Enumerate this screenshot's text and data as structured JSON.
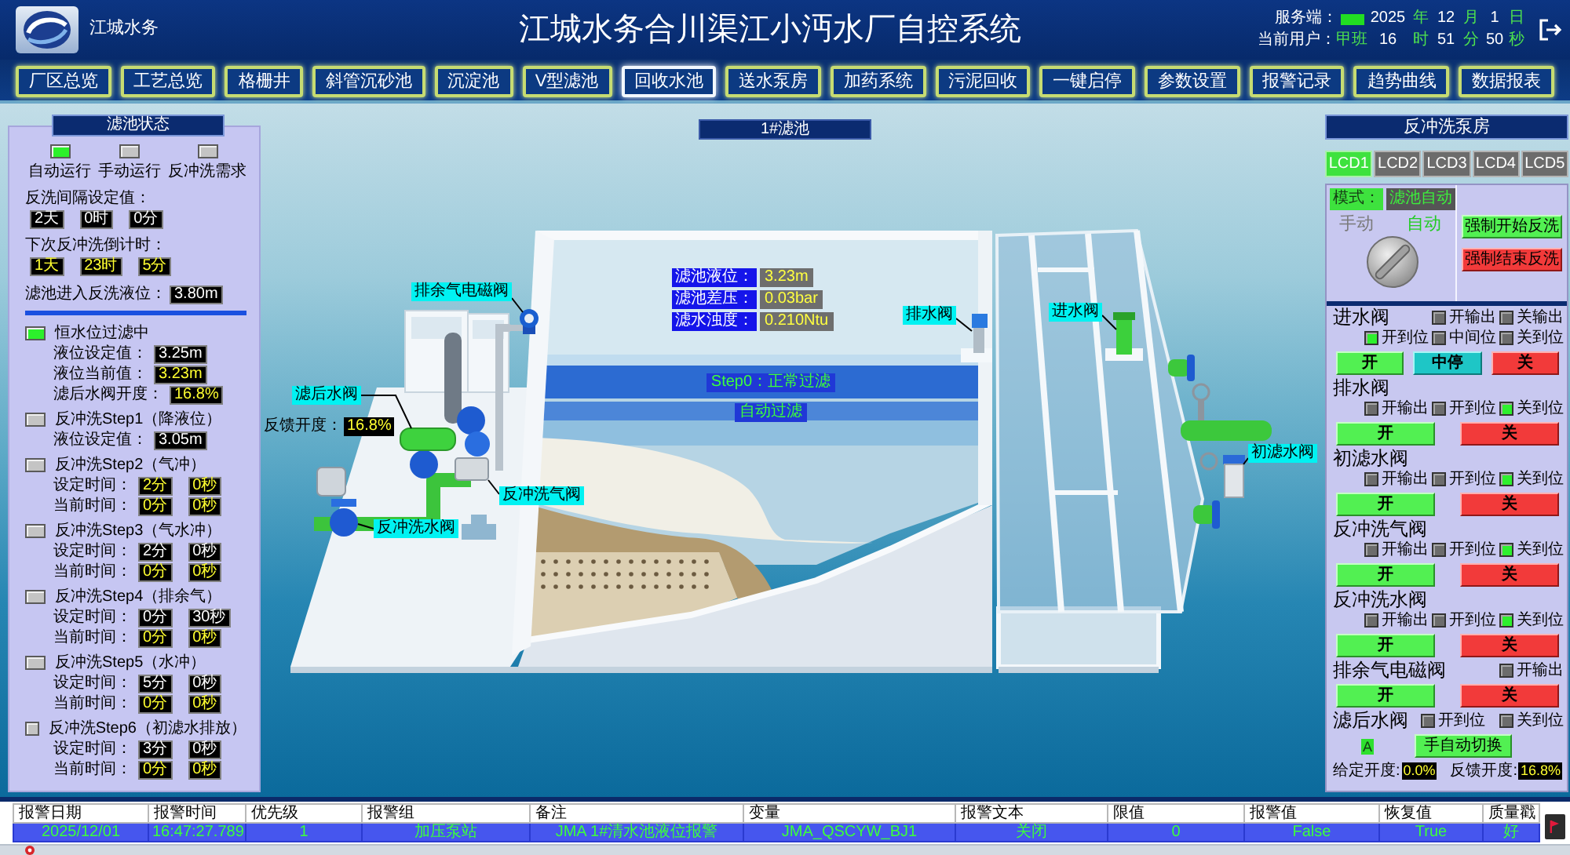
{
  "header": {
    "logo_text": "江城水务",
    "title": "江城水务合川渠江小沔水厂自控系统",
    "server": {
      "label": "服务端：",
      "online": true
    },
    "date": [
      {
        "value": "2025",
        "unit": "年"
      },
      {
        "value": "12",
        "unit": "月"
      },
      {
        "value": "1",
        "unit": "日"
      }
    ],
    "user": {
      "label": "当前用户：",
      "value": "甲班"
    },
    "time": [
      {
        "value": "16",
        "unit": "时"
      },
      {
        "value": "51",
        "unit": "分"
      },
      {
        "value": "50",
        "unit": "秒"
      }
    ]
  },
  "nav": [
    {
      "label": "厂区总览",
      "selected": false
    },
    {
      "label": "工艺总览",
      "selected": false
    },
    {
      "label": "格栅井",
      "selected": false
    },
    {
      "label": "斜管沉砂池",
      "selected": false
    },
    {
      "label": "沉淀池",
      "selected": false
    },
    {
      "label": "V型滤池",
      "selected": false
    },
    {
      "label": "回收水池",
      "selected": true
    },
    {
      "label": "送水泵房",
      "selected": false
    },
    {
      "label": "加药系统",
      "selected": false
    },
    {
      "label": "污泥回收",
      "selected": false
    },
    {
      "label": "一键启停",
      "selected": false
    },
    {
      "label": "参数设置",
      "selected": false
    },
    {
      "label": "报警记录",
      "selected": false
    },
    {
      "label": "趋势曲线",
      "selected": false
    },
    {
      "label": "数据报表",
      "selected": false
    }
  ],
  "filter_status": {
    "title": "滤池状态",
    "indicators": [
      {
        "label": "自动运行",
        "on": true
      },
      {
        "label": "手动运行",
        "on": false
      },
      {
        "label": "反冲洗需求",
        "on": false
      }
    ],
    "timers": [
      {
        "label": "反洗间隔设定值：",
        "values": [
          {
            "text": "2天",
            "kind": "setpoint"
          },
          {
            "text": "0时",
            "kind": "setpoint"
          },
          {
            "text": "0分",
            "kind": "setpoint"
          }
        ]
      },
      {
        "label": "下次反冲洗倒计时：",
        "values": [
          {
            "text": "1天",
            "kind": "reading"
          },
          {
            "text": "23时",
            "kind": "reading"
          },
          {
            "text": "5分",
            "kind": "reading"
          }
        ]
      }
    ],
    "backwash_level": {
      "label": "滤池进入反洗液位：",
      "value": {
        "text": "3.80m",
        "kind": "setpoint"
      }
    },
    "steps": [
      {
        "title": "恒水位过滤中",
        "on": true,
        "rows": [
          {
            "label": "液位设定值：",
            "values": [
              {
                "text": "3.25m",
                "kind": "setpoint"
              }
            ]
          },
          {
            "label": "液位当前值：",
            "values": [
              {
                "text": "3.23m",
                "kind": "reading"
              }
            ]
          },
          {
            "label": "滤后水阀开度：",
            "values": [
              {
                "text": "16.8%",
                "kind": "reading"
              }
            ]
          }
        ]
      },
      {
        "title": "反冲洗Step1（降液位）",
        "on": false,
        "rows": [
          {
            "label": "液位设定值：",
            "values": [
              {
                "text": "3.05m",
                "kind": "setpoint"
              }
            ]
          }
        ]
      },
      {
        "title": "反冲洗Step2（气冲）",
        "on": false,
        "rows": [
          {
            "label": "设定时间：",
            "values": [
              {
                "text": "2分",
                "kind": "reading"
              },
              {
                "text": "0秒",
                "kind": "reading"
              }
            ]
          },
          {
            "label": "当前时间：",
            "values": [
              {
                "text": "0分",
                "kind": "reading"
              },
              {
                "text": "0秒",
                "kind": "reading"
              }
            ]
          }
        ]
      },
      {
        "title": "反冲洗Step3（气水冲）",
        "on": false,
        "rows": [
          {
            "label": "设定时间：",
            "values": [
              {
                "text": "2分",
                "kind": "setpoint"
              },
              {
                "text": "0秒",
                "kind": "setpoint"
              }
            ]
          },
          {
            "label": "当前时间：",
            "values": [
              {
                "text": "0分",
                "kind": "reading"
              },
              {
                "text": "0秒",
                "kind": "reading"
              }
            ]
          }
        ]
      },
      {
        "title": "反冲洗Step4（排余气）",
        "on": false,
        "rows": [
          {
            "label": "设定时间：",
            "values": [
              {
                "text": "0分",
                "kind": "setpoint"
              },
              {
                "text": "30秒",
                "kind": "setpoint"
              }
            ]
          },
          {
            "label": "当前时间：",
            "values": [
              {
                "text": "0分",
                "kind": "reading"
              },
              {
                "text": "0秒",
                "kind": "reading"
              }
            ]
          }
        ]
      },
      {
        "title": "反冲洗Step5（水冲）",
        "on": false,
        "rows": [
          {
            "label": "设定时间：",
            "values": [
              {
                "text": "5分",
                "kind": "setpoint"
              },
              {
                "text": "0秒",
                "kind": "setpoint"
              }
            ]
          },
          {
            "label": "当前时间：",
            "values": [
              {
                "text": "0分",
                "kind": "reading"
              },
              {
                "text": "0秒",
                "kind": "reading"
              }
            ]
          }
        ]
      },
      {
        "title": "反冲洗Step6（初滤水排放）",
        "on": false,
        "rows": [
          {
            "label": "设定时间：",
            "values": [
              {
                "text": "3分",
                "kind": "setpoint"
              },
              {
                "text": "0秒",
                "kind": "setpoint"
              }
            ]
          },
          {
            "label": "当前时间：",
            "values": [
              {
                "text": "0分",
                "kind": "reading"
              },
              {
                "text": "0秒",
                "kind": "reading"
              }
            ]
          }
        ]
      }
    ]
  },
  "basin": {
    "title": "1#滤池",
    "readings": [
      {
        "label": "滤池液位：",
        "value": "3.23m"
      },
      {
        "label": "滤池差压：",
        "value": "0.03bar"
      },
      {
        "label": "滤水浊度：",
        "value": "0.210Ntu"
      }
    ],
    "step": "Step0：正常过滤",
    "mode": "自动过滤",
    "valves": [
      {
        "label": "排余气电磁阀"
      },
      {
        "label": "排水阀"
      },
      {
        "label": "进水阀"
      },
      {
        "label": "滤后水阀"
      },
      {
        "label": "初滤水阀"
      },
      {
        "label": "反冲洗气阀"
      },
      {
        "label": "反冲洗水阀"
      }
    ],
    "feedback": {
      "label": "反馈开度：",
      "value": "16.8%"
    }
  },
  "pump_room": {
    "title": "反冲洗泵房",
    "tabs": [
      {
        "label": "LCD1",
        "selected": true
      },
      {
        "label": "LCD2",
        "selected": false
      },
      {
        "label": "LCD3",
        "selected": false
      },
      {
        "label": "LCD4",
        "selected": false
      },
      {
        "label": "LCD5",
        "selected": false
      }
    ],
    "mode": {
      "label": "模式：",
      "value": "滤池自动",
      "switch": [
        {
          "label": "手动",
          "selected": false
        },
        {
          "label": "自动",
          "selected": true
        }
      ],
      "buttons": [
        {
          "label": "强制开始反洗",
          "kind": "start"
        },
        {
          "label": "强制结束反洗",
          "kind": "stop"
        }
      ]
    },
    "valves": [
      {
        "name": "进水阀",
        "signal_rows": [
          [
            {
              "label": "开输出",
              "on": false
            },
            {
              "label": "关输出",
              "on": false
            }
          ],
          [
            {
              "label": "开到位",
              "on": true
            },
            {
              "label": "中间位",
              "on": false
            },
            {
              "label": "关到位",
              "on": false
            }
          ]
        ],
        "buttons": [
          {
            "label": "开",
            "kind": "open"
          },
          {
            "label": "中停",
            "kind": "pause"
          },
          {
            "label": "关",
            "kind": "close"
          }
        ]
      },
      {
        "name": "排水阀",
        "signal_rows": [
          [
            {
              "label": "开输出",
              "on": false
            },
            {
              "label": "开到位",
              "on": false
            },
            {
              "label": "关到位",
              "on": true
            }
          ]
        ],
        "buttons": [
          {
            "label": "开",
            "kind": "open"
          },
          {
            "label": "关",
            "kind": "close"
          }
        ]
      },
      {
        "name": "初滤水阀",
        "signal_rows": [
          [
            {
              "label": "开输出",
              "on": false
            },
            {
              "label": "开到位",
              "on": false
            },
            {
              "label": "关到位",
              "on": true
            }
          ]
        ],
        "buttons": [
          {
            "label": "开",
            "kind": "open"
          },
          {
            "label": "关",
            "kind": "close"
          }
        ]
      },
      {
        "name": "反冲洗气阀",
        "signal_rows": [
          [
            {
              "label": "开输出",
              "on": false
            },
            {
              "label": "开到位",
              "on": false
            },
            {
              "label": "关到位",
              "on": true
            }
          ]
        ],
        "buttons": [
          {
            "label": "开",
            "kind": "open"
          },
          {
            "label": "关",
            "kind": "close"
          }
        ]
      },
      {
        "name": "反冲洗水阀",
        "signal_rows": [
          [
            {
              "label": "开输出",
              "on": false
            },
            {
              "label": "开到位",
              "on": false
            },
            {
              "label": "关到位",
              "on": true
            }
          ]
        ],
        "buttons": [
          {
            "label": "开",
            "kind": "open"
          },
          {
            "label": "关",
            "kind": "close"
          }
        ]
      },
      {
        "name": "排余气电磁阀",
        "signal_rows": [
          [
            {
              "label": "开输出",
              "on": false
            }
          ]
        ],
        "buttons": [
          {
            "label": "开",
            "kind": "open"
          },
          {
            "label": "关",
            "kind": "close"
          }
        ]
      }
    ],
    "outlet_valve": {
      "name": "滤后水阀",
      "signals": [
        {
          "label": "开到位",
          "on": false
        },
        {
          "label": "关到位",
          "on": false
        }
      ],
      "flag": "A",
      "switch_button": "手自动切换",
      "setpoint": {
        "label": "给定开度:",
        "value": "0.0%"
      },
      "feedback": {
        "label": "反馈开度:",
        "value": "16.8%"
      }
    }
  },
  "alarm_table": {
    "columns": [
      "报警日期",
      "报警时间",
      "优先级",
      "报警组",
      "备注",
      "变量",
      "报警文本",
      "限值",
      "报警值",
      "恢复值",
      "质量戳"
    ],
    "rows": [
      {
        "selected": true,
        "cells": [
          "2025/12/01",
          "16:47:27.789",
          "1",
          "加压泵站",
          "JMA 1#清水池液位报警",
          "JMA_QSCYW_BJ1",
          "关闭",
          "0",
          "False",
          "True",
          "好"
        ]
      }
    ]
  }
}
